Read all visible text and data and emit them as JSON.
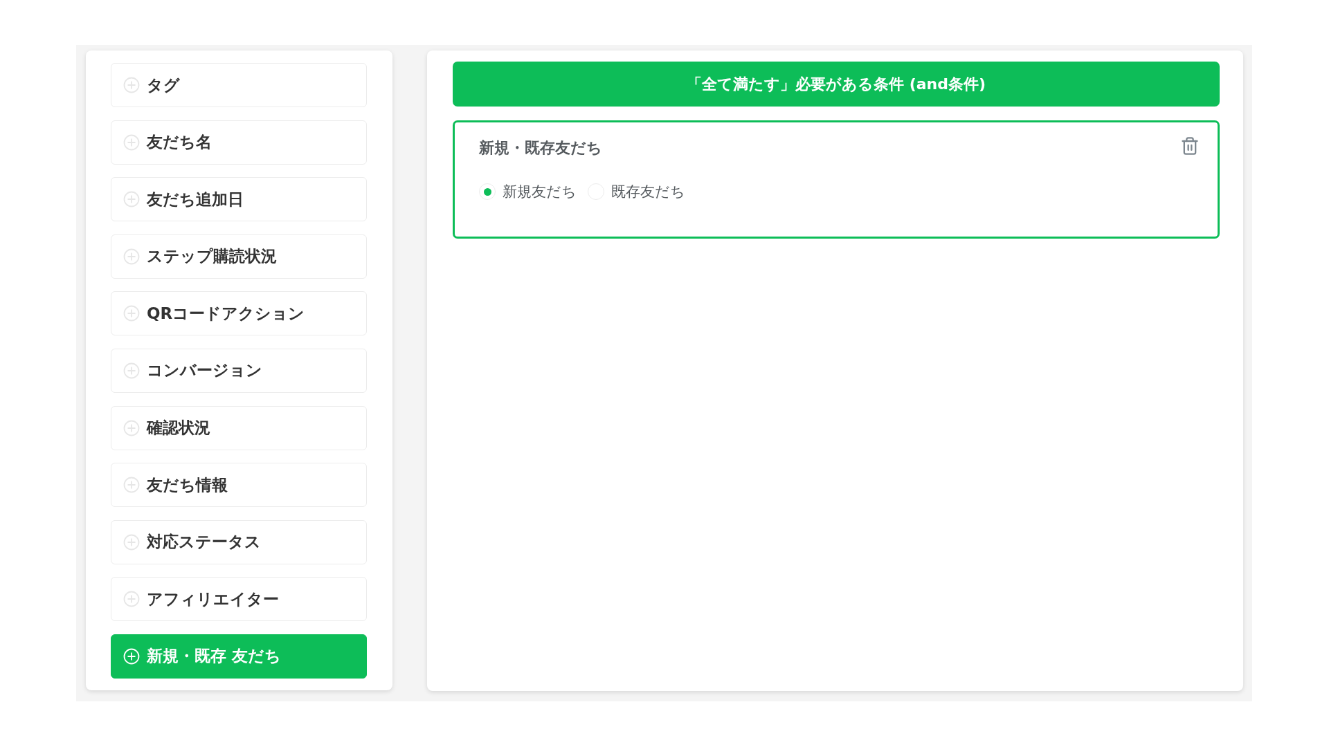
{
  "sidebar": {
    "items": [
      {
        "label": "タグ",
        "selected": false
      },
      {
        "label": "友だち名",
        "selected": false
      },
      {
        "label": "友だち追加日",
        "selected": false
      },
      {
        "label": "ステップ購読状況",
        "selected": false
      },
      {
        "label": "QRコードアクション",
        "selected": false
      },
      {
        "label": "コンバージョン",
        "selected": false
      },
      {
        "label": "確認状況",
        "selected": false
      },
      {
        "label": "友だち情報",
        "selected": false
      },
      {
        "label": "対応ステータス",
        "selected": false
      },
      {
        "label": "アフィリエイター",
        "selected": false
      },
      {
        "label": "新規・既存 友だち",
        "selected": true
      }
    ]
  },
  "condition_header": {
    "title": "「全て満たす」必要がある条件 (and条件)"
  },
  "condition_card": {
    "title": "新規・既存友だち",
    "options": [
      {
        "label": "新規友だち",
        "selected": true
      },
      {
        "label": "既存友だち",
        "selected": false
      }
    ]
  }
}
